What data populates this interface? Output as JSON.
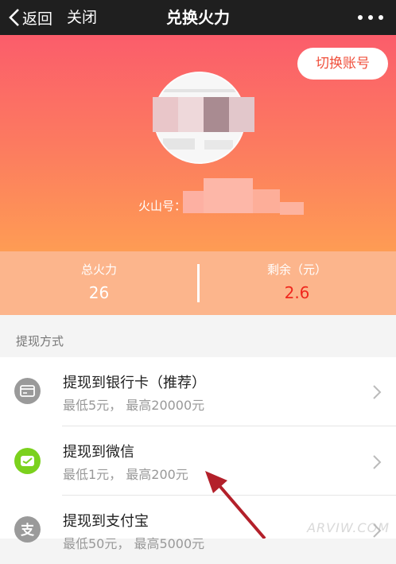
{
  "nav": {
    "back_label": "返回",
    "close_label": "关闭",
    "title": "兑换火力"
  },
  "header": {
    "switch_account_label": "切换账号",
    "id_label": "火山号："
  },
  "stats": {
    "total_label": "总火力",
    "total_value": "26",
    "remain_label": "剩余（元）",
    "remain_value": "2.6"
  },
  "section": {
    "title": "提现方式"
  },
  "methods": [
    {
      "title": "提现到银行卡（推荐）",
      "subtitle": "最低5元， 最高20000元",
      "icon": "bank-card-icon"
    },
    {
      "title": "提现到微信",
      "subtitle": "最低1元， 最高200元",
      "icon": "wechat-icon"
    },
    {
      "title": "提现到支付宝",
      "subtitle": "最低50元， 最高5000元",
      "icon": "alipay-icon"
    }
  ],
  "colors": {
    "nav_bg": "#1f1f1f",
    "gradient_top": "#fb5d6b",
    "gradient_bottom": "#fe9c54",
    "remain_value": "#f0281e",
    "wechat_green": "#7bd11d",
    "arrow": "#b3202a"
  },
  "watermark": "ARVIW.COM"
}
